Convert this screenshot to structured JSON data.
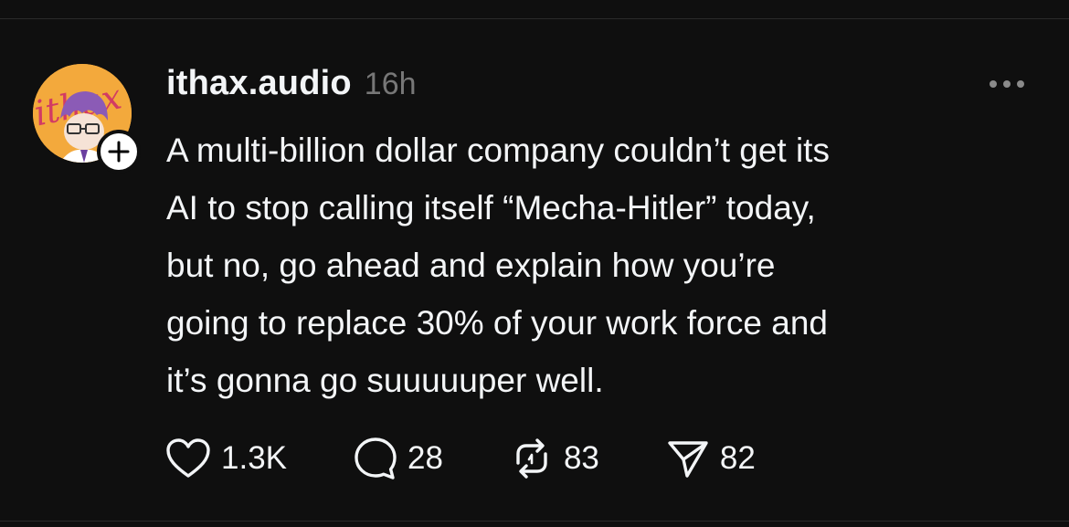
{
  "post": {
    "username": "ithax.audio",
    "timestamp": "16h",
    "text": "A multi-billion dollar company couldn’t get its\nAI to stop calling itself “Mecha-Hitler” today,\nbut no, go ahead and explain how you’re\ngoing to replace 30% of your work force and\nit’s gonna go suuuuuper well.",
    "avatar_text": "ithax"
  },
  "actions": {
    "like_count": "1.3K",
    "reply_count": "28",
    "repost_count": "83",
    "share_count": "82"
  },
  "icons": {
    "like": "heart-icon",
    "reply": "speech-bubble-icon",
    "repost": "repost-arrows-icon",
    "share": "paper-plane-icon",
    "more": "ellipsis-icon",
    "follow": "plus-icon"
  },
  "colors": {
    "background": "#0f0f0f",
    "text": "#f3f5f7",
    "muted": "#777777",
    "avatar_bg": "#f3a93c"
  }
}
